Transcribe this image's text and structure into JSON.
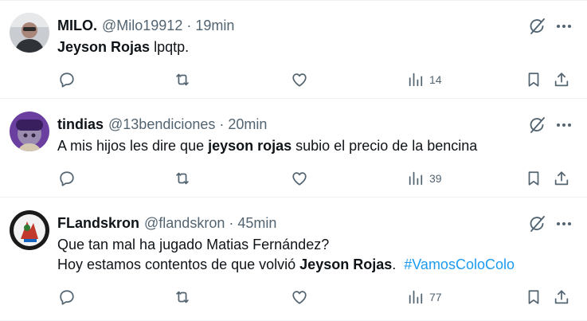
{
  "colors": {
    "text": "#0f1419",
    "secondary": "#536471",
    "hashtag": "#1d9bf0",
    "divider": "#eff3f4"
  },
  "icons": [
    "reply-icon",
    "retweet-icon",
    "like-icon",
    "views-icon",
    "bookmark-icon",
    "share-icon",
    "grok-icon",
    "more-icon"
  ],
  "tweets": [
    {
      "name": "MILO.",
      "handle": "@Milo19912",
      "separator": "·",
      "time": "19min",
      "text_bold": "Jeyson Rojas",
      "text_rest": " lpqtp.",
      "views": "14"
    },
    {
      "name": "tindias",
      "handle": "@13bendiciones",
      "separator": "·",
      "time": "20min",
      "text_pre": "A mis hijos les dire que ",
      "text_bold": "jeyson rojas",
      "text_post": " subio el precio de la bencina",
      "views": "39"
    },
    {
      "name": "FLandskron",
      "handle": "@flandskron",
      "separator": "·",
      "time": "45min",
      "line1": "Que tan mal ha jugado Matias Fernández?",
      "line2_pre": "Hoy estamos contentos de que volvió ",
      "line2_bold": "Jeyson Rojas",
      "line2_post": ".  ",
      "hashtag": "#VamosColoColo",
      "views": "77"
    }
  ]
}
